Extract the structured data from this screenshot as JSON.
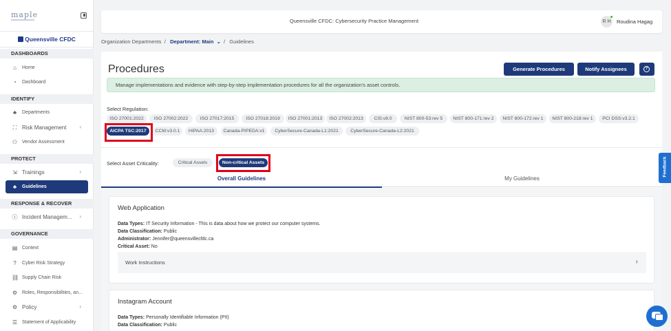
{
  "sidebar": {
    "logo": "maple",
    "org_name": "Queensville CFDC",
    "sections": {
      "dashboards": "DASHBOARDS",
      "identify": "IDENTIFY",
      "protect": "PROTECT",
      "response": "RESPONSE & RECOVER",
      "governance": "GOVERNANCE"
    },
    "items": {
      "home": "Home",
      "dashboard": "Dashboard",
      "departments": "Departments",
      "risk": "Risk Management",
      "vendor": "Vendor Assessment",
      "trainings": "Trainings",
      "guidelines": "Guidelines",
      "incident": "Incident Managem...",
      "context": "Context",
      "cyber_risk": "Cyber Risk Strategy",
      "supply": "Supply Chain Risk",
      "roles": "Roles, Responsibilities, an...",
      "policy": "Policy",
      "soa": "Statement of Applicability"
    }
  },
  "header": {
    "title": "Queensville CFDC: Cybersecurity Practice Management",
    "user_initials": "R H",
    "user_name": "Roudina Hagag"
  },
  "breadcrumb": {
    "org_departments": "Organization Departments",
    "department": "Department: Main",
    "current": "Guidelines"
  },
  "page": {
    "title": "Procedures",
    "generate_btn": "Generate Procedures",
    "notify_btn": "Notify Assignees",
    "info": "Manage implementations and evidence with step-by-step implementation procedures for all the organization's asset controls.",
    "select_regulation": "Select Regulation:",
    "regulations_row1": [
      "ISO 27001:2022",
      "ISO 27002:2022",
      "ISO 27017:2015",
      "ISO 27018:2019",
      "ISO 27001:2013",
      "ISO 27002:2013",
      "CIS:v8.0",
      "NIST 800-53:rev 5",
      "NIST 800-171:rev 2",
      "NIST 800-172:rev 1",
      "NIST 800-218:rev 1",
      "PCI DSS:v3.2.1"
    ],
    "regulations_row2": [
      "AICPA TSC:2017",
      "CCM:v3.0.1",
      "HIPAA:2013",
      "Canada-PIPEDA:v1",
      "CyberSecure-Canada-L1:2021",
      "CyberSecure-Canada-L2:2021"
    ],
    "select_criticality": "Select Asset Criticality:",
    "criticality": [
      "Critical Assets",
      "Non-critical Assets"
    ],
    "tabs": [
      "Overall Guidelines",
      "My Guidelines"
    ]
  },
  "cards": [
    {
      "title": "Web Application",
      "data_types_label": "Data Types:",
      "data_types": "IT Security Information - This is data about how we protect our computer systems.",
      "classification_label": "Data Classification:",
      "classification": "Public",
      "admin_label": "Administrator:",
      "admin": "Jennifer@queensvillecfdc.ca",
      "critical_label": "Critical Asset:",
      "critical": "No",
      "work_instructions": "Work Instructions"
    },
    {
      "title": "Instagram Account",
      "data_types_label": "Data Types:",
      "data_types": "Personally Identifiable Information (PII)",
      "classification_label": "Data Classification:",
      "classification": "Public"
    }
  ],
  "feedback": "Feedback",
  "colors": {
    "primary": "#1f3a7a",
    "highlight": "#e0001b",
    "info_bg": "#dcefe3",
    "chat": "#1f6fd1"
  }
}
